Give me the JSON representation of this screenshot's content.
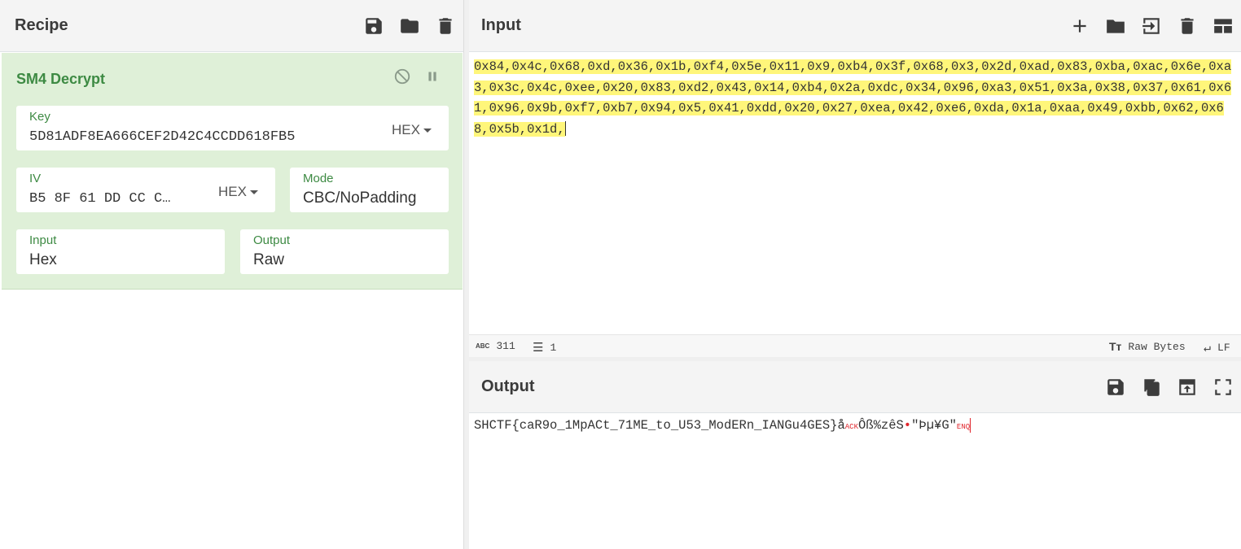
{
  "recipe": {
    "title": "Recipe",
    "icons": [
      "save-icon",
      "folder-icon",
      "trash-icon"
    ]
  },
  "operation": {
    "name": "SM4 Decrypt",
    "key": {
      "label": "Key",
      "value": "5D81ADF8EA666CEF2D42C4CCDD618FB5",
      "encoding": "HEX"
    },
    "iv": {
      "label": "IV",
      "value": "B5 8F 61 DD CC C…",
      "encoding": "HEX"
    },
    "mode": {
      "label": "Mode",
      "value": "CBC/NoPadding"
    },
    "input": {
      "label": "Input",
      "value": "Hex"
    },
    "output": {
      "label": "Output",
      "value": "Raw"
    }
  },
  "input": {
    "title": "Input",
    "text": "0x84,0x4c,0x68,0xd,0x36,0x1b,0xf4,0x5e,0x11,0x9,0xb4,0x3f,0x68,0x3,0x2d,0xad,0x83,0xba,0xac,0x6e,0xa3,0x3c,0x4c,0xee,0x20,0x83,0xd2,0x43,0x14,0xb4,0x2a,0xdc,0x34,0x96,0xa3,0x51,0x3a,0x38,0x37,0x61,0x61,0x96,0x9b,0xf7,0xb7,0x94,0x5,0x41,0xdd,0x20,0x27,0xea,0x42,0xe6,0xda,0x1a,0xaa,0x49,0xbb,0x62,0x68,0x5b,0x1d,",
    "status": {
      "length_icon": "ABC",
      "length": "311",
      "lines": "1",
      "encoding": "Raw Bytes",
      "eol": "LF"
    }
  },
  "output": {
    "title": "Output",
    "text_main": "SHCTF{caR9o_1MpACt_71ME_to_U53_ModERn_IANGu4GES}å",
    "ctl1": "ACK",
    "text_mid": "Ôß%zêS",
    "dot": "•",
    "text_end": "\"Þµ¥G\"",
    "ctl2": "ENQ"
  }
}
